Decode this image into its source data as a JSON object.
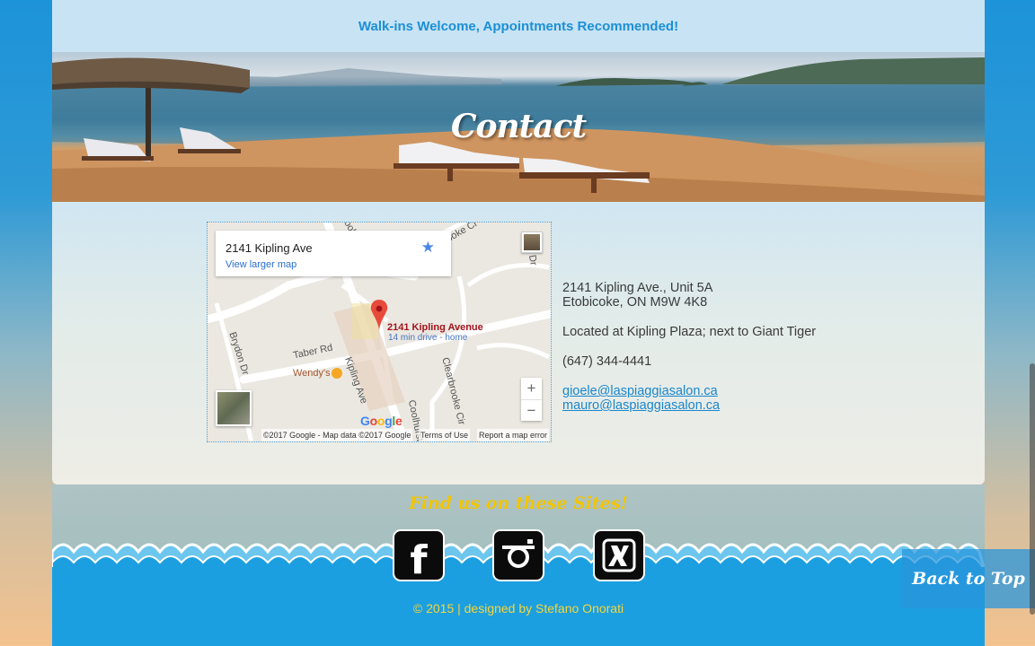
{
  "announcement": "Walk-ins Welcome, Appointments Recommended!",
  "banner": {
    "title": "Contact"
  },
  "map": {
    "card_address": "2141 Kipling Ave",
    "card_link": "View larger map",
    "pin_title": "2141 Kipling Avenue",
    "pin_subtitle": "14 min drive - home",
    "poi": "Wendy's",
    "roads": [
      "Taber Rd",
      "Kipling Ave",
      "Brydon Dr",
      "Clearbrooke Cir",
      "Coolhurst",
      "ooke Ci",
      "ook",
      "Dr"
    ],
    "zoom_in": "+",
    "zoom_out": "−",
    "logo": "Google",
    "footer": {
      "data": "©2017 Google - Map data ©2017 Google",
      "terms": "Terms of Use",
      "report": "Report a map error"
    }
  },
  "contact": {
    "address_line1": "2141 Kipling Ave., Unit 5A",
    "address_line2": "Etobicoke, ON M9W 4K8",
    "location_note": "Located at Kipling Plaza; next to Giant Tiger",
    "phone": "(647) 344-4441",
    "email1": "gioele@laspiaggiasalon.ca",
    "email2": "mauro@laspiaggiasalon.ca"
  },
  "footer": {
    "find_us": "Find us on these Sites!",
    "social": [
      "facebook-icon",
      "instagram-icon",
      "yellow-pages-icon"
    ],
    "copyright": "© 2015 | designed by Stefano Onorati"
  },
  "back_to_top": "Back to Top",
  "colors": {
    "accent": "#1c8fd6",
    "link": "#1a86cc",
    "gold": "#f3c500",
    "sea": "#1c9fe0"
  }
}
